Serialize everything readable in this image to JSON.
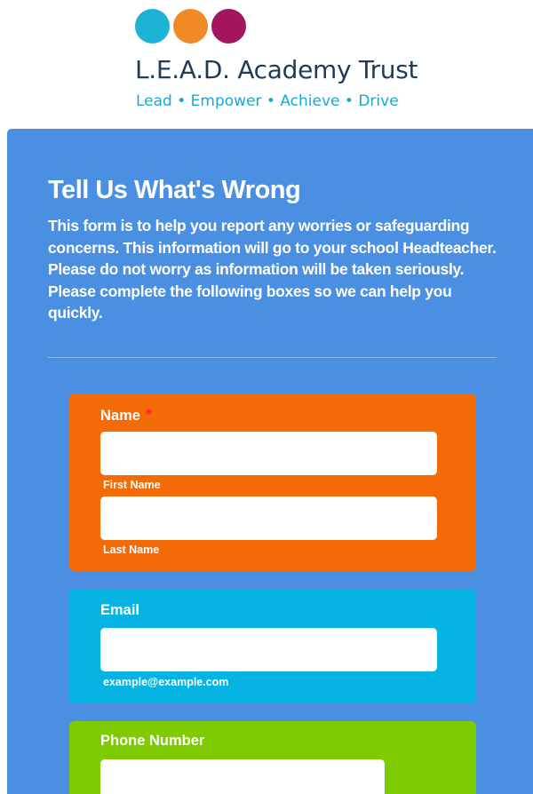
{
  "brand": {
    "name": "L.E.A.D. Academy Trust",
    "tagline": "Lead • Empower • Achieve • Drive",
    "dot_colors": [
      "#1cb3d6",
      "#f08a24",
      "#a4155e"
    ]
  },
  "form": {
    "title": "Tell Us What's Wrong",
    "description": "This form is to help you report any worries or safeguarding concerns. This information will go to your school Headteacher. Please do not worry as information will be taken seriously. Please complete the following boxes so we can help you quickly.",
    "fields": {
      "name": {
        "label": "Name",
        "required_mark": "*",
        "first_value": "",
        "first_sublabel": "First Name",
        "last_value": "",
        "last_sublabel": "Last Name",
        "color": "#f46a06"
      },
      "email": {
        "label": "Email",
        "value": "",
        "sublabel": "example@example.com",
        "color": "#06b4e4"
      },
      "phone": {
        "label": "Phone Number",
        "value": "",
        "color": "#7fcb02"
      }
    }
  },
  "colors": {
    "form_background": "#4a8fe2",
    "brand_text": "#1e3b5a",
    "tagline_text": "#17a9d4",
    "required": "#ff2a2a"
  }
}
